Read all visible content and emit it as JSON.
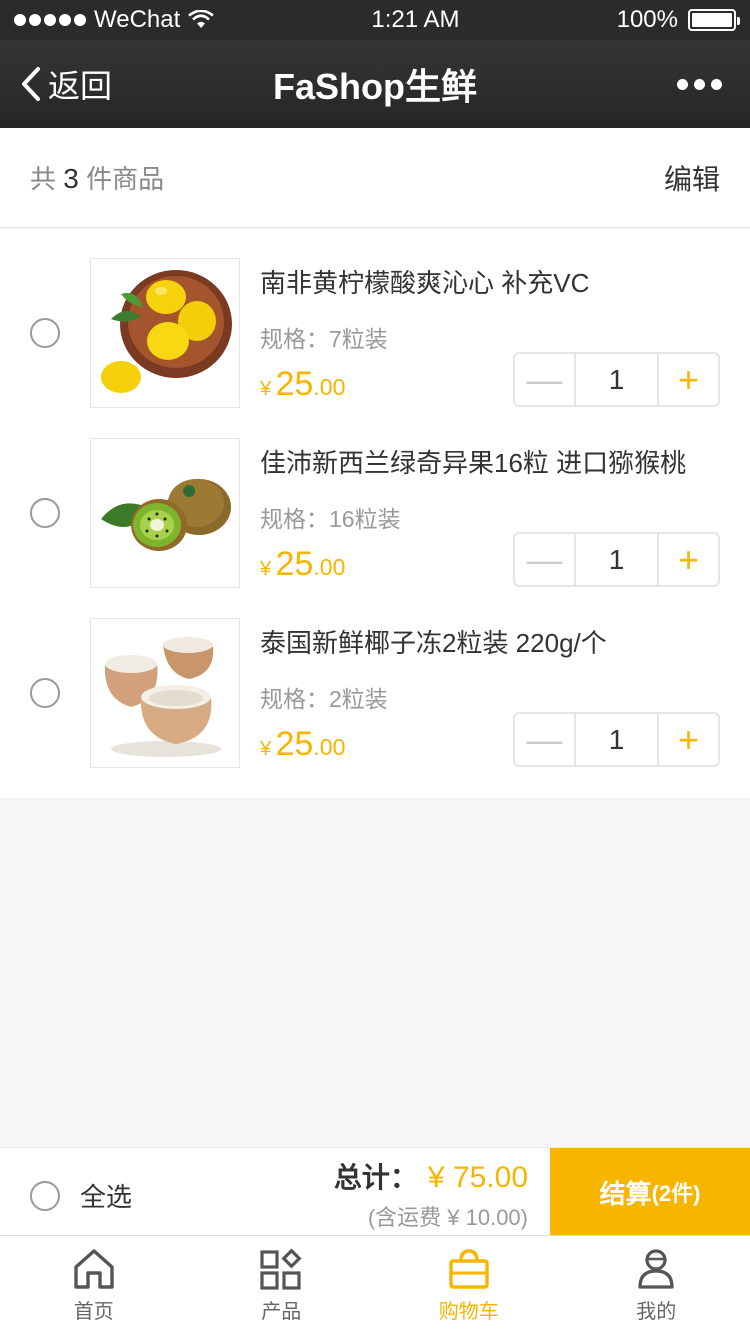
{
  "status_bar": {
    "carrier": "WeChat",
    "time": "1:21 AM",
    "battery": "100%"
  },
  "nav": {
    "back_label": "返回",
    "title": "FaShop生鲜"
  },
  "summary": {
    "prefix": "共",
    "count": "3",
    "suffix": "件商品",
    "edit_label": "编辑"
  },
  "items": [
    {
      "name": "南非黄柠檬酸爽沁心 补充VC",
      "spec": "规格：7粒装",
      "currency": "¥",
      "price_int": "25",
      "price_dec": ".00",
      "quantity": "1",
      "image": "lemon"
    },
    {
      "name": "佳沛新西兰绿奇异果16粒 进口猕猴桃",
      "spec": "规格：16粒装",
      "currency": "¥",
      "price_int": "25",
      "price_dec": ".00",
      "quantity": "1",
      "image": "kiwi"
    },
    {
      "name": "泰国新鲜椰子冻2粒装   220g/个",
      "spec": "规格：2粒装",
      "currency": "¥",
      "price_int": "25",
      "price_dec": ".00",
      "quantity": "1",
      "image": "coconut"
    }
  ],
  "stepper": {
    "minus": "—",
    "plus": "+"
  },
  "checkout": {
    "select_all_label": "全选",
    "total_label": "总计：",
    "total_amount": "¥ 75.00",
    "shipping_note": "(含运费 ¥ 10.00)",
    "button_label": "结算",
    "button_count": "(2件)"
  },
  "tabs": [
    {
      "label": "首页",
      "icon": "home-icon",
      "active": false
    },
    {
      "label": "产品",
      "icon": "grid-icon",
      "active": false
    },
    {
      "label": "购物车",
      "icon": "bag-icon",
      "active": true
    },
    {
      "label": "我的",
      "icon": "user-icon",
      "active": false
    }
  ],
  "colors": {
    "accent": "#f7b500",
    "nav_bg": "#2b2b2b"
  }
}
